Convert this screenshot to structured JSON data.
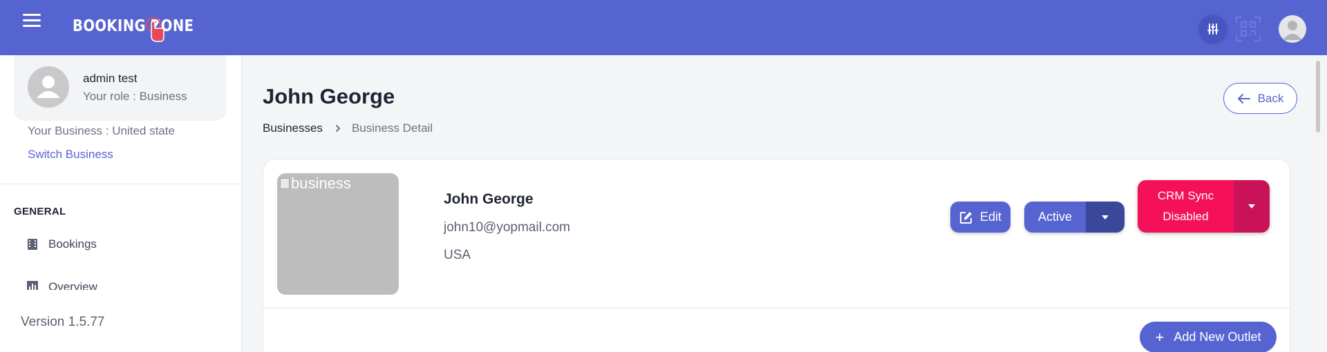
{
  "header": {
    "logo_text": "BOOKING ZONE",
    "accent_color": "#5664d2",
    "icons": [
      "menu-icon",
      "sliders-icon",
      "qr-scan-icon",
      "user-avatar-icon"
    ]
  },
  "sidebar": {
    "user_name": "admin test",
    "user_role": "Your role : Business",
    "business_line": "Your Business : United state",
    "switch_business_label": "Switch Business",
    "section_label": "GENERAL",
    "nav": [
      {
        "label": "Bookings",
        "icon": "bookings-icon"
      },
      {
        "label": "Overview",
        "icon": "chart-icon"
      }
    ],
    "version": "Version 1.5.77"
  },
  "main": {
    "title": "John George",
    "breadcrumb": {
      "parent": "Businesses",
      "current": "Business Detail"
    },
    "back_label": "Back",
    "business": {
      "image_alt": "business",
      "name": "John George",
      "email": "john10@yopmail.com",
      "country": "USA"
    },
    "actions": {
      "edit_label": "Edit",
      "status_label": "Active",
      "crm_line1": "CRM Sync",
      "crm_line2": "Disabled",
      "add_outlet_label": "Add New Outlet"
    },
    "colors": {
      "crm": "#f5105a",
      "crm_dark": "#c91257",
      "status_dark": "#3b479b"
    }
  }
}
